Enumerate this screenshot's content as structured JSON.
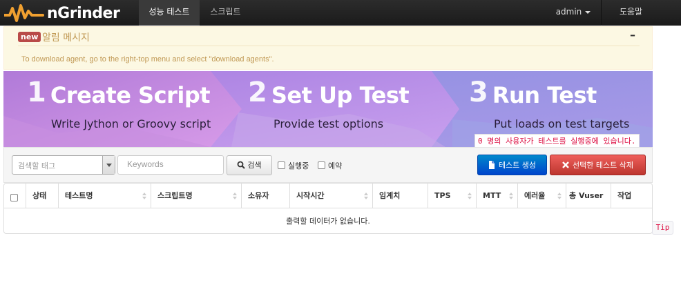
{
  "brand": {
    "name": "nGrinder",
    "logo_color": "#f0a030"
  },
  "nav": {
    "tabs": [
      {
        "label": "성능 테스트",
        "active": true
      },
      {
        "label": "스크립트",
        "active": false
      }
    ],
    "user": "admin",
    "help": "도움말"
  },
  "alert": {
    "badge": "new",
    "title": "알림 메시지",
    "minimize": "–",
    "message": "To download agent, go to the right-top menu and select \"download agents\"."
  },
  "banner": {
    "steps": [
      {
        "number": "1",
        "title": "Create Script",
        "subtitle": "Write Jython or Groovy script"
      },
      {
        "number": "2",
        "title": "Set Up Test",
        "subtitle": "Provide test options"
      },
      {
        "number": "3",
        "title": "Run Test",
        "subtitle": "Put loads on test targets"
      }
    ],
    "user_count": "0 명의 사용자가 테스트를 실행중에 있습니다."
  },
  "toolbar": {
    "tag_placeholder": "검색할 태그",
    "keyword_placeholder": "Keywords",
    "search_label": "검색",
    "filter_running": "실행중",
    "filter_scheduled": "예약",
    "create_label": "테스트 생성",
    "delete_label": "선택한 테스트 삭제"
  },
  "table": {
    "columns": [
      "상태",
      "테스트명",
      "스크립트명",
      "소유자",
      "시작시간",
      "임계치",
      "TPS",
      "MTT",
      "에러율",
      "총 Vuser",
      "작업"
    ],
    "empty_message": "출력할 데이터가 없습니다."
  },
  "tip": "Tip",
  "colors": {
    "accent": "#0044cc",
    "danger": "#bd362f",
    "topbar": "#1b1b1b"
  }
}
